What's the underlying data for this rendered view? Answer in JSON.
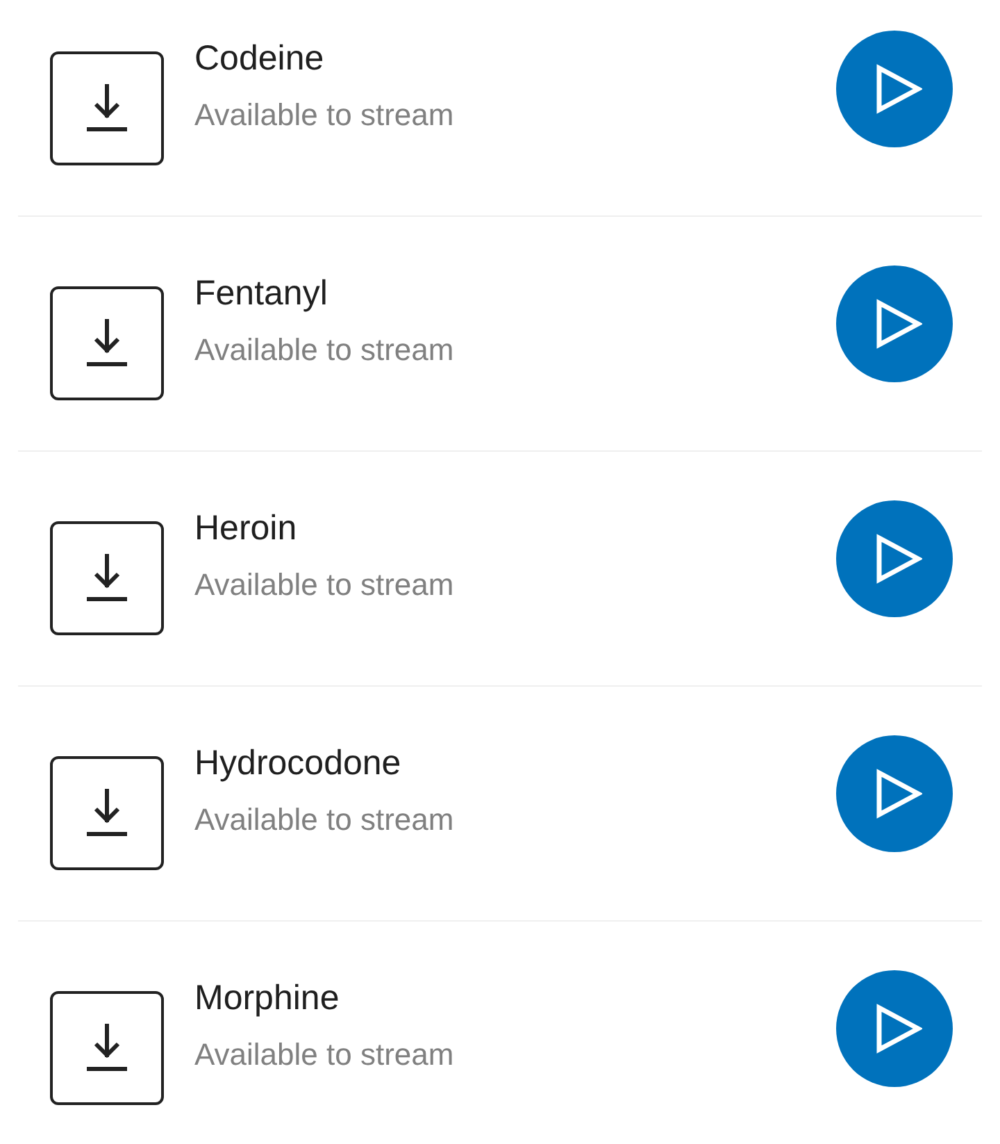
{
  "tracks": [
    {
      "title": "Codeine",
      "status": "Available to stream"
    },
    {
      "title": "Fentanyl",
      "status": "Available to stream"
    },
    {
      "title": "Heroin",
      "status": "Available to stream"
    },
    {
      "title": "Hydrocodone",
      "status": "Available to stream"
    },
    {
      "title": "Morphine",
      "status": "Available to stream"
    }
  ]
}
